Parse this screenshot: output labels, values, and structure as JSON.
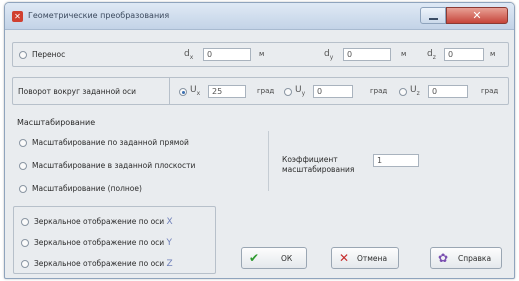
{
  "window": {
    "title": "Геометрические преобразования",
    "close_glyph": "✕"
  },
  "translate": {
    "radio_label": "Перенос",
    "fields": [
      {
        "symbol": "d",
        "sub": "x",
        "value": "0",
        "unit": "м"
      },
      {
        "symbol": "d",
        "sub": "y",
        "value": "0",
        "unit": "м"
      },
      {
        "symbol": "d",
        "sub": "z",
        "value": "0",
        "unit": "м"
      }
    ]
  },
  "rotate": {
    "label": "Поворот вокруг заданной оси",
    "fields": [
      {
        "symbol": "U",
        "sub": "x",
        "value": "25",
        "unit": "град",
        "checked": true
      },
      {
        "symbol": "U",
        "sub": "y",
        "value": "0",
        "unit": "град",
        "checked": false
      },
      {
        "symbol": "U",
        "sub": "z",
        "value": "0",
        "unit": "град",
        "checked": false
      }
    ]
  },
  "scale": {
    "heading": "Масштабирование",
    "options": [
      "Масштабирование по заданной прямой",
      "Масштабирование в заданной плоскости",
      "Масштабирование (полное)"
    ],
    "coef_label_1": "Коэффициент",
    "coef_label_2": "масштабирования",
    "coef_value": "1"
  },
  "mirror": {
    "options": [
      {
        "text": "Зеркальное отображение по оси",
        "axis": "X"
      },
      {
        "text": "Зеркальное отображение по оси",
        "axis": "Y"
      },
      {
        "text": "Зеркальное отображение по оси",
        "axis": "Z"
      }
    ]
  },
  "buttons": {
    "ok": "ОК",
    "cancel": "Отмена",
    "help": "Справка"
  },
  "colors": {
    "accent": "#3a6fb0",
    "ok_icon": "#2e9a2e",
    "cancel_icon": "#c62d2d",
    "help_icon": "#7a4fb0",
    "axis_letter": "#6f7fb8"
  }
}
